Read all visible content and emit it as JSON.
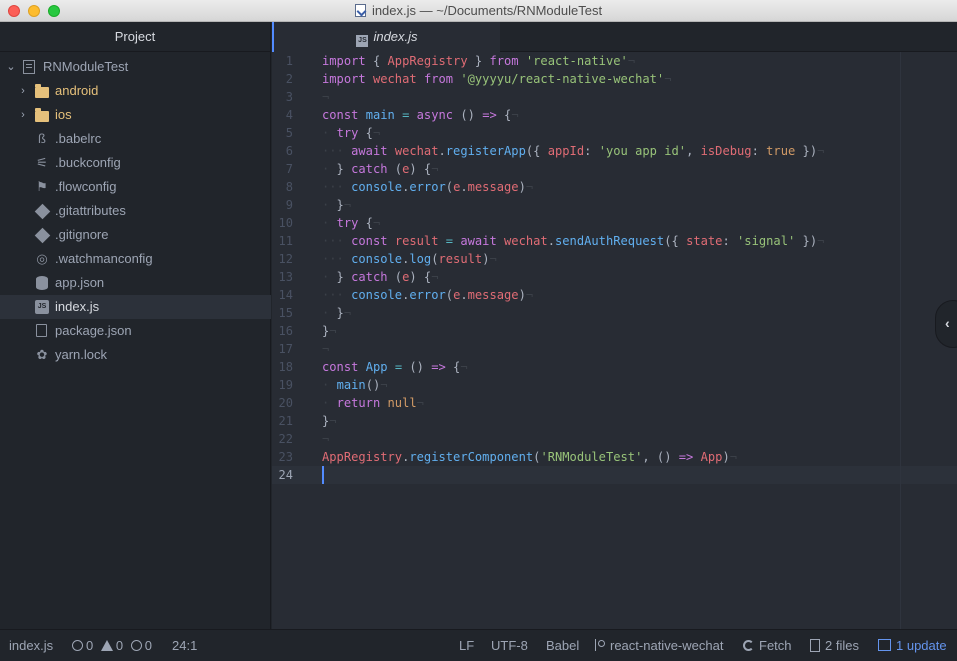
{
  "window": {
    "title": "index.js — ~/Documents/RNModuleTest"
  },
  "sidebar": {
    "header": "Project",
    "root": "RNModuleTest",
    "items": [
      {
        "label": "android",
        "kind": "folder"
      },
      {
        "label": "ios",
        "kind": "folder"
      },
      {
        "label": ".babelrc",
        "kind": "file",
        "icon": "babel-icon"
      },
      {
        "label": ".buckconfig",
        "kind": "file",
        "icon": "buck-icon"
      },
      {
        "label": ".flowconfig",
        "kind": "file",
        "icon": "flow-icon"
      },
      {
        "label": ".gitattributes",
        "kind": "file",
        "icon": "git-icon"
      },
      {
        "label": ".gitignore",
        "kind": "file",
        "icon": "git-icon"
      },
      {
        "label": ".watchmanconfig",
        "kind": "file",
        "icon": "watchman-icon"
      },
      {
        "label": "app.json",
        "kind": "file",
        "icon": "database-icon"
      },
      {
        "label": "index.js",
        "kind": "file",
        "icon": "js-icon",
        "selected": true
      },
      {
        "label": "package.json",
        "kind": "file",
        "icon": "package-icon"
      },
      {
        "label": "yarn.lock",
        "kind": "file",
        "icon": "yarn-icon"
      }
    ]
  },
  "tabs": [
    {
      "label": "index.js",
      "icon_text": "JS",
      "active": true
    }
  ],
  "editor": {
    "line_numbers": [
      "1",
      "2",
      "3",
      "4",
      "5",
      "6",
      "7",
      "8",
      "9",
      "10",
      "11",
      "12",
      "13",
      "14",
      "15",
      "16",
      "17",
      "18",
      "19",
      "20",
      "21",
      "22",
      "23",
      "24"
    ],
    "current_line": 24,
    "lines": [
      [
        [
          "k",
          "import"
        ],
        [
          "p",
          " { "
        ],
        [
          "v",
          "AppRegistry"
        ],
        [
          "p",
          " } "
        ],
        [
          "k",
          "from"
        ],
        [
          "p",
          " "
        ],
        [
          "s",
          "'react-native'"
        ],
        [
          "inv",
          "¬"
        ]
      ],
      [
        [
          "k",
          "import"
        ],
        [
          "p",
          " "
        ],
        [
          "v",
          "wechat"
        ],
        [
          "p",
          " "
        ],
        [
          "k",
          "from"
        ],
        [
          "p",
          " "
        ],
        [
          "s",
          "'@yyyyu/react-native-wechat'"
        ],
        [
          "inv",
          "¬"
        ]
      ],
      [
        [
          "inv",
          "¬"
        ]
      ],
      [
        [
          "k",
          "const"
        ],
        [
          "p",
          " "
        ],
        [
          "f",
          "main"
        ],
        [
          "p",
          " "
        ],
        [
          "o",
          "="
        ],
        [
          "p",
          " "
        ],
        [
          "k",
          "async"
        ],
        [
          "p",
          " () "
        ],
        [
          "k",
          "=>"
        ],
        [
          "p",
          " {"
        ],
        [
          "inv",
          "¬"
        ]
      ],
      [
        [
          "inv",
          "·"
        ],
        [
          "p",
          " "
        ],
        [
          "k",
          "try"
        ],
        [
          "p",
          " {"
        ],
        [
          "inv",
          "¬"
        ]
      ],
      [
        [
          "inv",
          "···"
        ],
        [
          "p",
          " "
        ],
        [
          "k",
          "await"
        ],
        [
          "p",
          " "
        ],
        [
          "v",
          "wechat"
        ],
        [
          "p",
          "."
        ],
        [
          "f",
          "registerApp"
        ],
        [
          "p",
          "({ "
        ],
        [
          "v",
          "appId"
        ],
        [
          "p",
          ": "
        ],
        [
          "s",
          "'you app id'"
        ],
        [
          "p",
          ", "
        ],
        [
          "v",
          "isDebug"
        ],
        [
          "p",
          ": "
        ],
        [
          "n",
          "true"
        ],
        [
          "p",
          " })"
        ],
        [
          "inv",
          "¬"
        ]
      ],
      [
        [
          "inv",
          "·"
        ],
        [
          "p",
          " } "
        ],
        [
          "k",
          "catch"
        ],
        [
          "p",
          " ("
        ],
        [
          "v",
          "e"
        ],
        [
          "p",
          ") {"
        ],
        [
          "inv",
          "¬"
        ]
      ],
      [
        [
          "inv",
          "···"
        ],
        [
          "p",
          " "
        ],
        [
          "f",
          "console"
        ],
        [
          "p",
          "."
        ],
        [
          "f",
          "error"
        ],
        [
          "p",
          "("
        ],
        [
          "v",
          "e"
        ],
        [
          "p",
          "."
        ],
        [
          "v",
          "message"
        ],
        [
          "p",
          ")"
        ],
        [
          "inv",
          "¬"
        ]
      ],
      [
        [
          "inv",
          "·"
        ],
        [
          "p",
          " }"
        ],
        [
          "inv",
          "¬"
        ]
      ],
      [
        [
          "inv",
          "·"
        ],
        [
          "p",
          " "
        ],
        [
          "k",
          "try"
        ],
        [
          "p",
          " {"
        ],
        [
          "inv",
          "¬"
        ]
      ],
      [
        [
          "inv",
          "···"
        ],
        [
          "p",
          " "
        ],
        [
          "k",
          "const"
        ],
        [
          "p",
          " "
        ],
        [
          "v",
          "result"
        ],
        [
          "p",
          " "
        ],
        [
          "o",
          "="
        ],
        [
          "p",
          " "
        ],
        [
          "k",
          "await"
        ],
        [
          "p",
          " "
        ],
        [
          "v",
          "wechat"
        ],
        [
          "p",
          "."
        ],
        [
          "f",
          "sendAuthRequest"
        ],
        [
          "p",
          "({ "
        ],
        [
          "v",
          "state"
        ],
        [
          "p",
          ": "
        ],
        [
          "s",
          "'signal'"
        ],
        [
          "p",
          " })"
        ],
        [
          "inv",
          "¬"
        ]
      ],
      [
        [
          "inv",
          "···"
        ],
        [
          "p",
          " "
        ],
        [
          "f",
          "console"
        ],
        [
          "p",
          "."
        ],
        [
          "f",
          "log"
        ],
        [
          "p",
          "("
        ],
        [
          "v",
          "result"
        ],
        [
          "p",
          ")"
        ],
        [
          "inv",
          "¬"
        ]
      ],
      [
        [
          "inv",
          "·"
        ],
        [
          "p",
          " } "
        ],
        [
          "k",
          "catch"
        ],
        [
          "p",
          " ("
        ],
        [
          "v",
          "e"
        ],
        [
          "p",
          ") {"
        ],
        [
          "inv",
          "¬"
        ]
      ],
      [
        [
          "inv",
          "···"
        ],
        [
          "p",
          " "
        ],
        [
          "f",
          "console"
        ],
        [
          "p",
          "."
        ],
        [
          "f",
          "error"
        ],
        [
          "p",
          "("
        ],
        [
          "v",
          "e"
        ],
        [
          "p",
          "."
        ],
        [
          "v",
          "message"
        ],
        [
          "p",
          ")"
        ],
        [
          "inv",
          "¬"
        ]
      ],
      [
        [
          "inv",
          "·"
        ],
        [
          "p",
          " }"
        ],
        [
          "inv",
          "¬"
        ]
      ],
      [
        [
          "p",
          "}"
        ],
        [
          "inv",
          "¬"
        ]
      ],
      [
        [
          "inv",
          "¬"
        ]
      ],
      [
        [
          "k",
          "const"
        ],
        [
          "p",
          " "
        ],
        [
          "f",
          "App"
        ],
        [
          "p",
          " "
        ],
        [
          "o",
          "="
        ],
        [
          "p",
          " () "
        ],
        [
          "k",
          "=>"
        ],
        [
          "p",
          " {"
        ],
        [
          "inv",
          "¬"
        ]
      ],
      [
        [
          "inv",
          "·"
        ],
        [
          "p",
          " "
        ],
        [
          "f",
          "main"
        ],
        [
          "p",
          "()"
        ],
        [
          "inv",
          "¬"
        ]
      ],
      [
        [
          "inv",
          "·"
        ],
        [
          "p",
          " "
        ],
        [
          "k",
          "return"
        ],
        [
          "p",
          " "
        ],
        [
          "n",
          "null"
        ],
        [
          "inv",
          "¬"
        ]
      ],
      [
        [
          "p",
          "}"
        ],
        [
          "inv",
          "¬"
        ]
      ],
      [
        [
          "inv",
          "¬"
        ]
      ],
      [
        [
          "v",
          "AppRegistry"
        ],
        [
          "p",
          "."
        ],
        [
          "f",
          "registerComponent"
        ],
        [
          "p",
          "("
        ],
        [
          "s",
          "'RNModuleTest'"
        ],
        [
          "p",
          ", () "
        ],
        [
          "k",
          "=>"
        ],
        [
          "p",
          " "
        ],
        [
          "v",
          "App"
        ],
        [
          "p",
          ")"
        ],
        [
          "inv",
          "¬"
        ]
      ],
      []
    ]
  },
  "statusbar": {
    "file": "index.js",
    "errors": "0",
    "warnings": "0",
    "infos": "0",
    "cursor": "24:1",
    "line_ending": "LF",
    "encoding": "UTF-8",
    "grammar": "Babel",
    "branch": "react-native-wechat",
    "fetch": "Fetch",
    "files": "2 files",
    "update": "1 update"
  },
  "colors": {
    "accent": "#528bff",
    "keyword": "#c678dd",
    "string": "#98c379",
    "function": "#61afef",
    "variable": "#e06c75",
    "folder": "#e5c07b"
  }
}
